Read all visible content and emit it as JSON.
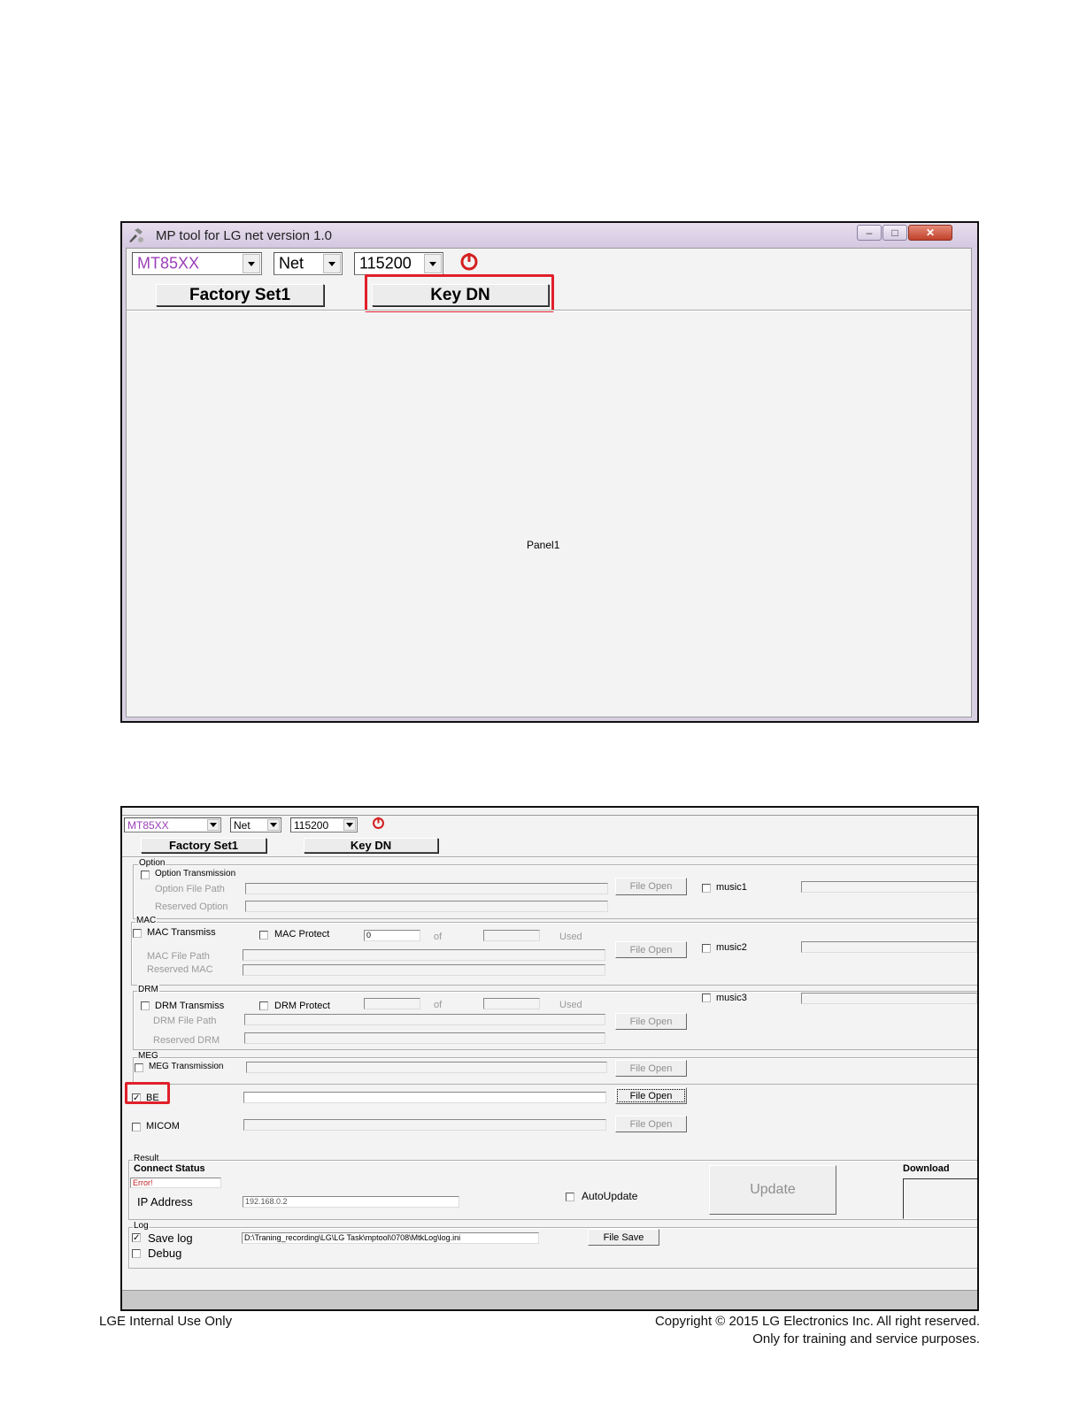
{
  "window1": {
    "title": "MP tool for LG net version 1.0",
    "close_glyph": "✕",
    "min_glyph": "–",
    "max_glyph": "□",
    "combo_chip": "MT85XX",
    "combo_type": "Net",
    "combo_baud": "115200",
    "factory_button": "Factory Set1",
    "keydn_button": "Key DN",
    "panel_caption": "Panel1",
    "chip_color": "#9b3fb8",
    "highlight_color": "#e0202a"
  },
  "window2": {
    "combo_chip": "MT85XX",
    "combo_type": "Net",
    "combo_baud": "115200",
    "factory_button": "Factory Set1",
    "keydn_button": "Key DN",
    "option": {
      "group": "Option",
      "transmission": "Option Transmission",
      "file_path": "Option File Path",
      "reserved": "Reserved Option",
      "file_open": "File Open",
      "music": "music1"
    },
    "mac": {
      "group": "MAC",
      "transmiss": "MAC Transmiss",
      "protect": "MAC Protect",
      "count_value": "0",
      "of": "of",
      "used": "Used",
      "file_path": "MAC File Path",
      "reserved": "Reserved MAC",
      "file_open": "File Open",
      "music": "music2"
    },
    "drm": {
      "group": "DRM",
      "transmiss": "DRM Transmiss",
      "protect": "DRM Protect",
      "of": "of",
      "used": "Used",
      "file_path": "DRM File Path",
      "reserved": "Reserved DRM",
      "file_open": "File Open",
      "music": "music3"
    },
    "meg": {
      "group": "MEG",
      "transmission": "MEG Transmission",
      "file_open": "File Open"
    },
    "be": {
      "label": "BE",
      "checked_glyph": "✓",
      "file_open": "File Open"
    },
    "micom": {
      "label": "MICOM",
      "file_open": "File Open"
    },
    "result": {
      "group": "Result",
      "connect_status": "Connect Status",
      "error_text": "Error!",
      "ip_label": "IP Address",
      "ip_value": "192.168.0.2",
      "autoupdate": "AutoUpdate",
      "update_button": "Update",
      "download": "Download"
    },
    "log": {
      "group": "Log",
      "save_log": "Save log",
      "checked_glyph": "✓",
      "debug": "Debug",
      "path": "D:\\Traning_recording\\LG\\LG Task\\mptool\\0708\\MtkLog\\log.ini",
      "file_save": "File Save"
    }
  },
  "footer": {
    "left": "LGE Internal Use Only",
    "right_line1": "Copyright © 2015 LG Electronics Inc. All right reserved.",
    "right_line2": "Only for training and service purposes."
  }
}
